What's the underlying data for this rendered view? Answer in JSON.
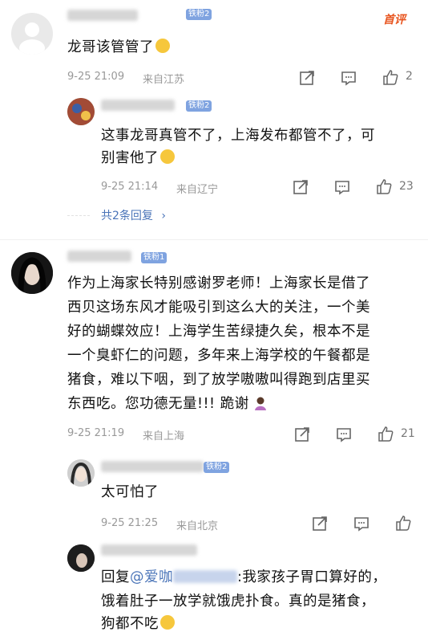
{
  "header": {
    "sort_label": "首评"
  },
  "comments": [
    {
      "badge": "铁粉2",
      "text": "龙哥该管管了",
      "time": "9-25 21:09",
      "location": "来自江苏",
      "likes": "2",
      "replies": [
        {
          "badge": "铁粉2",
          "text_line1": "这事龙哥真管不了，上海发布都管不了，可",
          "text_line2": "别害他了",
          "time": "9-25 21:14",
          "location": "来自辽宁",
          "likes": "23"
        }
      ],
      "more_replies": "共2条回复"
    },
    {
      "badge": "铁粉1",
      "lines": [
        "作为上海家长特别感谢罗老师！上海家长是借了",
        "西贝这场东风才能吸引到这么大的关注，一个美",
        "好的蝴蝶效应！上海学生苦绿捷久矣，根本不是",
        "一个臭虾仁的问题，多年来上海学校的午餐都是",
        "猪食，难以下咽，到了放学嗷嗷叫得跑到店里买",
        "东西吃。您功德无量!!! 跪谢"
      ],
      "time": "9-25 21:19",
      "location": "来自上海",
      "likes": "21",
      "replies": [
        {
          "badge": "铁粉2",
          "text": "太可怕了",
          "time": "9-25 21:25",
          "location": "来自北京"
        },
        {
          "reply_prefix": "回复",
          "reply_target": "@爱咖",
          "line1_rest": ":我家孩子胃口算好的，",
          "line2": "饿着肚子一放学就饿虎扑食。真的是猪食，",
          "line3": "狗都不吃"
        }
      ]
    }
  ],
  "colors": {
    "accent": "#4a74b8",
    "meta": "#999999",
    "badge": "#7fa3e0",
    "sort": "#e8541e"
  },
  "icons": [
    "share-icon",
    "comment-icon",
    "like-icon",
    "chevron-right-icon"
  ]
}
